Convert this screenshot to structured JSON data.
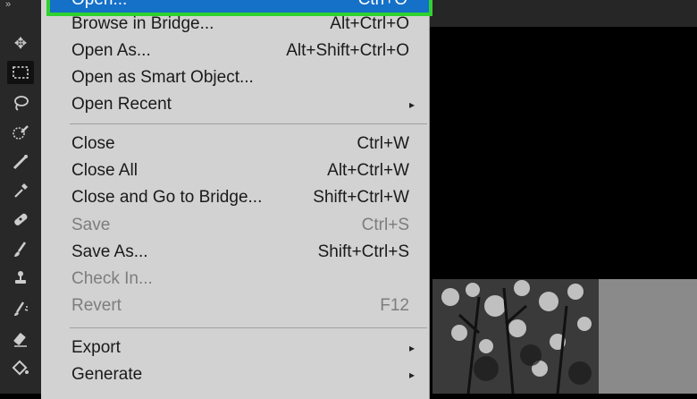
{
  "toolbar": {
    "collapse": "»",
    "tools": [
      {
        "name": "move-tool-icon",
        "glyph": "✥"
      },
      {
        "name": "rectangular-marquee-tool-icon",
        "glyph": ""
      },
      {
        "name": "lasso-tool-icon",
        "glyph": "ℒ"
      },
      {
        "name": "quick-selection-tool-icon",
        "glyph": "✎"
      },
      {
        "name": "crop-tool-icon",
        "glyph": "⟋"
      },
      {
        "name": "eyedropper-tool-icon",
        "glyph": "✐"
      },
      {
        "name": "healing-brush-tool-icon",
        "glyph": "✚"
      },
      {
        "name": "brush-tool-icon",
        "glyph": "⟋"
      },
      {
        "name": "clone-stamp-tool-icon",
        "glyph": "⚲"
      },
      {
        "name": "history-brush-tool-icon",
        "glyph": "✦"
      },
      {
        "name": "eraser-tool-icon",
        "glyph": "⌫"
      },
      {
        "name": "paint-bucket-tool-icon",
        "glyph": "⛋"
      }
    ]
  },
  "menu": {
    "highlighted": {
      "label": "Open...",
      "shortcut": "Ctrl+O"
    },
    "items": [
      {
        "label": "Browse in Bridge...",
        "shortcut": "Alt+Ctrl+O",
        "disabled": false
      },
      {
        "label": "Open As...",
        "shortcut": "Alt+Shift+Ctrl+O",
        "disabled": false
      },
      {
        "label": "Open as Smart Object...",
        "shortcut": "",
        "disabled": false
      },
      {
        "label": "Open Recent",
        "shortcut": "",
        "disabled": false,
        "submenu": "▸"
      },
      {
        "label": "Close",
        "shortcut": "Ctrl+W",
        "disabled": false
      },
      {
        "label": "Close All",
        "shortcut": "Alt+Ctrl+W",
        "disabled": false
      },
      {
        "label": "Close and Go to Bridge...",
        "shortcut": "Shift+Ctrl+W",
        "disabled": false
      },
      {
        "label": "Save",
        "shortcut": "Ctrl+S",
        "disabled": true
      },
      {
        "label": "Save As...",
        "shortcut": "Shift+Ctrl+S",
        "disabled": false
      },
      {
        "label": "Check In...",
        "shortcut": "",
        "disabled": true
      },
      {
        "label": "Revert",
        "shortcut": "F12",
        "disabled": true
      },
      {
        "label": "Export",
        "shortcut": "",
        "disabled": false,
        "submenu": "▸"
      },
      {
        "label": "Generate",
        "shortcut": "",
        "disabled": false,
        "submenu": "▸"
      }
    ]
  },
  "colors": {
    "highlight": "#1570c8",
    "highlight_outline": "#2fd22f",
    "menu_bg": "#d2d2d2",
    "disabled_text": "#7d7d7d"
  }
}
